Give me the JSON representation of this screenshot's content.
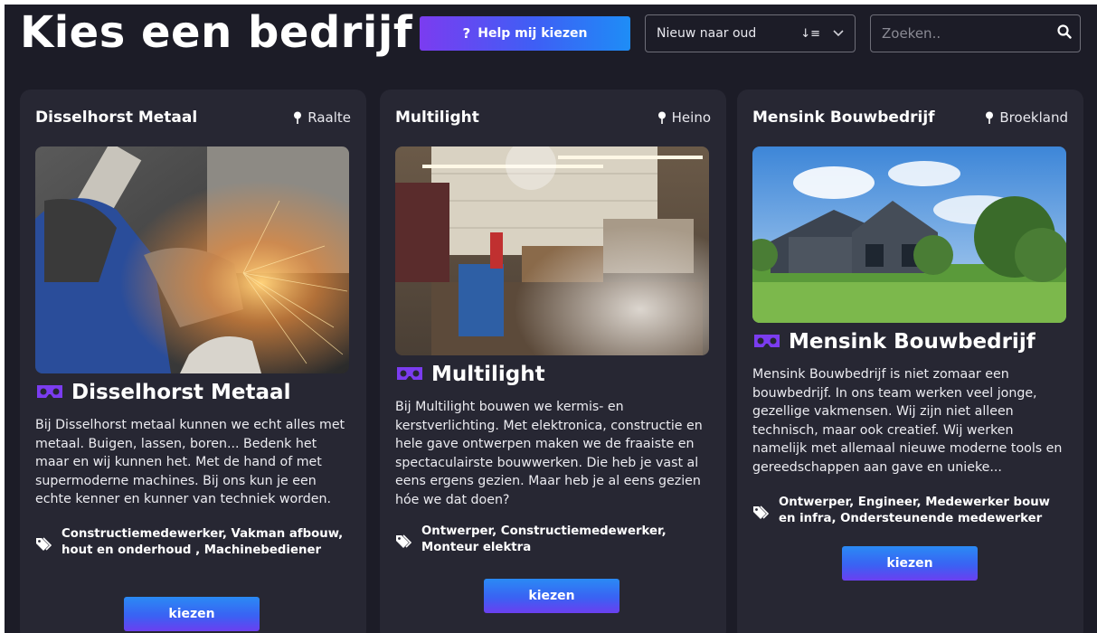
{
  "header": {
    "title": "Kies een bedrijf",
    "help_label": "Help mij kiezen",
    "help_icon": "?",
    "sort": {
      "selected": "Nieuw naar oud",
      "icon": "sort-icon"
    },
    "search": {
      "placeholder": "Zoeken..",
      "value": ""
    }
  },
  "colors": {
    "background": "#1c1c27",
    "card": "#272733",
    "accent_purple": "#7b3cf0",
    "accent_blue": "#1e8df6"
  },
  "companies": [
    {
      "name": "Disselhorst Metaal",
      "location": "Raalte",
      "heading": "Disselhorst Metaal",
      "description": "Bij Disselhorst metaal kunnen we echt alles met metaal. Buigen, lassen, boren... Bedenk het maar en wij kunnen het. Met de hand of met supermoderne machines. Bij ons kun je een echte kenner en kunner van techniek worden.",
      "tags": "Constructiemedewerker, Vakman afbouw, hout en onderhoud , Machinebediener",
      "button": "kiezen"
    },
    {
      "name": "Multilight",
      "location": "Heino",
      "heading": "Multilight",
      "description": "Bij Multilight bouwen we kermis- en kerstverlichting. Met elektronica, constructie en hele gave ontwerpen maken we de fraaiste en spectaculairste bouwwerken. Die heb je vast al eens ergens gezien. Maar heb je al eens gezien hóe we dat doen?",
      "tags": "Ontwerper, Constructiemedewerker, Monteur elektra",
      "button": "kiezen"
    },
    {
      "name": "Mensink Bouwbedrijf",
      "location": "Broekland",
      "heading": "Mensink Bouwbedrijf",
      "description": "Mensink Bouwbedrijf is niet zomaar een bouwbedrijf. In ons team werken veel jonge, gezellige vakmensen. Wij zijn niet alleen technisch, maar ook creatief. Wij werken namelijk met allemaal nieuwe moderne tools en gereedschappen aan gave en unieke...",
      "tags": "Ontwerper, Engineer, Medewerker bouw en infra, Ondersteunende medewerker",
      "button": "kiezen"
    }
  ]
}
